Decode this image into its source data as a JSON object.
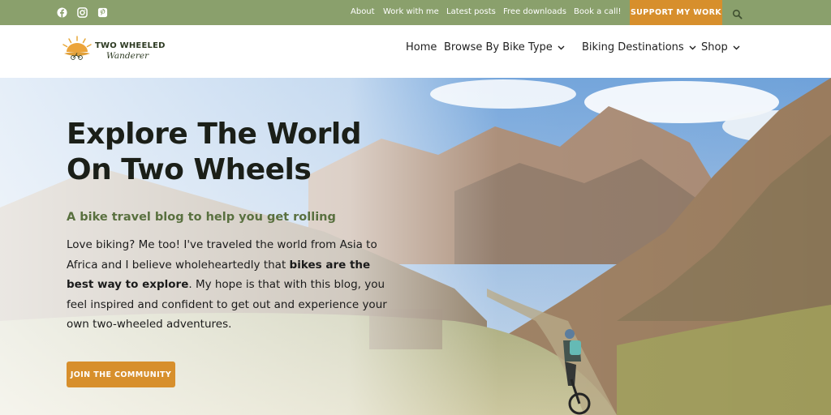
{
  "topbar": {
    "social": [
      {
        "name": "facebook-icon"
      },
      {
        "name": "instagram-icon"
      },
      {
        "name": "pinterest-icon"
      }
    ],
    "links": [
      "About",
      "Work with me",
      "Latest posts",
      "Free downloads",
      "Book a call!"
    ],
    "support_label": "SUPPORT MY WORK",
    "search_icon": "search-icon",
    "colors": {
      "bar": "#8aa06c",
      "accent": "#d78f2c"
    }
  },
  "header": {
    "logo": {
      "title": "TWO WHEELED",
      "subtitle": "Wanderer"
    },
    "nav": [
      {
        "label": "Home",
        "dropdown": false
      },
      {
        "label": "Browse By Bike Type",
        "dropdown": true
      },
      {
        "label": "Biking Destinations",
        "dropdown": true
      },
      {
        "label": "Shop",
        "dropdown": true
      }
    ]
  },
  "hero": {
    "title_line1": "Explore The World",
    "title_line2": "On Two Wheels",
    "subtitle": "A bike travel blog to help you get rolling",
    "body_part1": "Love biking? Me too! I've traveled the world from Asia to Africa and I believe wholeheartedly that ",
    "body_bold": "bikes are the best way to explore",
    "body_part2": ". My hope is that with this blog, you feel inspired and confident to get out and experience your own two-wheeled adventures.",
    "cta_label": "JOIN THE COMMUNITY",
    "subtitle_color": "#59703f"
  }
}
